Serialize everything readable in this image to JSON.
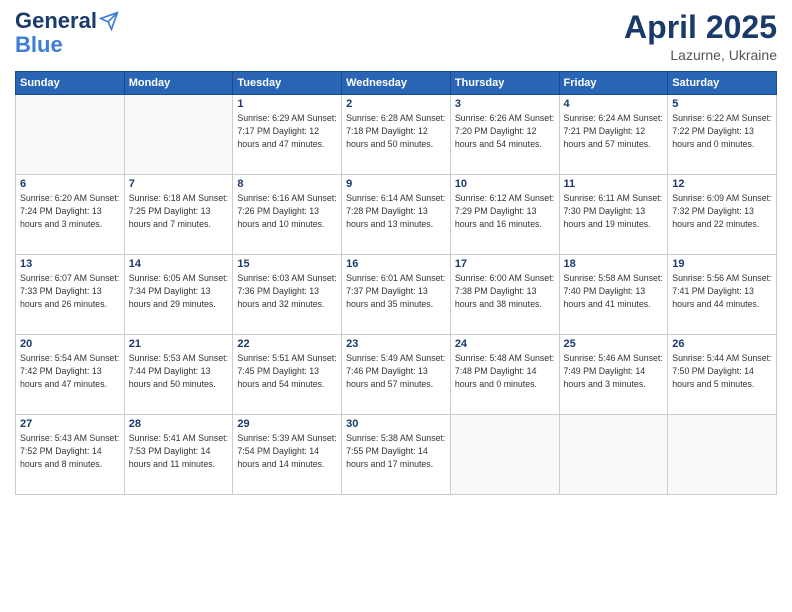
{
  "header": {
    "logo_general": "General",
    "logo_blue": "Blue",
    "month_title": "April 2025",
    "location": "Lazurne, Ukraine"
  },
  "days_of_week": [
    "Sunday",
    "Monday",
    "Tuesday",
    "Wednesday",
    "Thursday",
    "Friday",
    "Saturday"
  ],
  "weeks": [
    [
      {
        "day": "",
        "info": ""
      },
      {
        "day": "",
        "info": ""
      },
      {
        "day": "1",
        "info": "Sunrise: 6:29 AM\nSunset: 7:17 PM\nDaylight: 12 hours and 47 minutes."
      },
      {
        "day": "2",
        "info": "Sunrise: 6:28 AM\nSunset: 7:18 PM\nDaylight: 12 hours and 50 minutes."
      },
      {
        "day": "3",
        "info": "Sunrise: 6:26 AM\nSunset: 7:20 PM\nDaylight: 12 hours and 54 minutes."
      },
      {
        "day": "4",
        "info": "Sunrise: 6:24 AM\nSunset: 7:21 PM\nDaylight: 12 hours and 57 minutes."
      },
      {
        "day": "5",
        "info": "Sunrise: 6:22 AM\nSunset: 7:22 PM\nDaylight: 13 hours and 0 minutes."
      }
    ],
    [
      {
        "day": "6",
        "info": "Sunrise: 6:20 AM\nSunset: 7:24 PM\nDaylight: 13 hours and 3 minutes."
      },
      {
        "day": "7",
        "info": "Sunrise: 6:18 AM\nSunset: 7:25 PM\nDaylight: 13 hours and 7 minutes."
      },
      {
        "day": "8",
        "info": "Sunrise: 6:16 AM\nSunset: 7:26 PM\nDaylight: 13 hours and 10 minutes."
      },
      {
        "day": "9",
        "info": "Sunrise: 6:14 AM\nSunset: 7:28 PM\nDaylight: 13 hours and 13 minutes."
      },
      {
        "day": "10",
        "info": "Sunrise: 6:12 AM\nSunset: 7:29 PM\nDaylight: 13 hours and 16 minutes."
      },
      {
        "day": "11",
        "info": "Sunrise: 6:11 AM\nSunset: 7:30 PM\nDaylight: 13 hours and 19 minutes."
      },
      {
        "day": "12",
        "info": "Sunrise: 6:09 AM\nSunset: 7:32 PM\nDaylight: 13 hours and 22 minutes."
      }
    ],
    [
      {
        "day": "13",
        "info": "Sunrise: 6:07 AM\nSunset: 7:33 PM\nDaylight: 13 hours and 26 minutes."
      },
      {
        "day": "14",
        "info": "Sunrise: 6:05 AM\nSunset: 7:34 PM\nDaylight: 13 hours and 29 minutes."
      },
      {
        "day": "15",
        "info": "Sunrise: 6:03 AM\nSunset: 7:36 PM\nDaylight: 13 hours and 32 minutes."
      },
      {
        "day": "16",
        "info": "Sunrise: 6:01 AM\nSunset: 7:37 PM\nDaylight: 13 hours and 35 minutes."
      },
      {
        "day": "17",
        "info": "Sunrise: 6:00 AM\nSunset: 7:38 PM\nDaylight: 13 hours and 38 minutes."
      },
      {
        "day": "18",
        "info": "Sunrise: 5:58 AM\nSunset: 7:40 PM\nDaylight: 13 hours and 41 minutes."
      },
      {
        "day": "19",
        "info": "Sunrise: 5:56 AM\nSunset: 7:41 PM\nDaylight: 13 hours and 44 minutes."
      }
    ],
    [
      {
        "day": "20",
        "info": "Sunrise: 5:54 AM\nSunset: 7:42 PM\nDaylight: 13 hours and 47 minutes."
      },
      {
        "day": "21",
        "info": "Sunrise: 5:53 AM\nSunset: 7:44 PM\nDaylight: 13 hours and 50 minutes."
      },
      {
        "day": "22",
        "info": "Sunrise: 5:51 AM\nSunset: 7:45 PM\nDaylight: 13 hours and 54 minutes."
      },
      {
        "day": "23",
        "info": "Sunrise: 5:49 AM\nSunset: 7:46 PM\nDaylight: 13 hours and 57 minutes."
      },
      {
        "day": "24",
        "info": "Sunrise: 5:48 AM\nSunset: 7:48 PM\nDaylight: 14 hours and 0 minutes."
      },
      {
        "day": "25",
        "info": "Sunrise: 5:46 AM\nSunset: 7:49 PM\nDaylight: 14 hours and 3 minutes."
      },
      {
        "day": "26",
        "info": "Sunrise: 5:44 AM\nSunset: 7:50 PM\nDaylight: 14 hours and 5 minutes."
      }
    ],
    [
      {
        "day": "27",
        "info": "Sunrise: 5:43 AM\nSunset: 7:52 PM\nDaylight: 14 hours and 8 minutes."
      },
      {
        "day": "28",
        "info": "Sunrise: 5:41 AM\nSunset: 7:53 PM\nDaylight: 14 hours and 11 minutes."
      },
      {
        "day": "29",
        "info": "Sunrise: 5:39 AM\nSunset: 7:54 PM\nDaylight: 14 hours and 14 minutes."
      },
      {
        "day": "30",
        "info": "Sunrise: 5:38 AM\nSunset: 7:55 PM\nDaylight: 14 hours and 17 minutes."
      },
      {
        "day": "",
        "info": ""
      },
      {
        "day": "",
        "info": ""
      },
      {
        "day": "",
        "info": ""
      }
    ]
  ]
}
